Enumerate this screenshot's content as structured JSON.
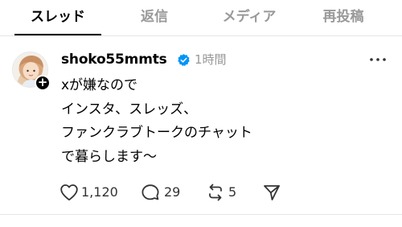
{
  "tabs": [
    {
      "label": "スレッド",
      "active": true
    },
    {
      "label": "返信",
      "active": false
    },
    {
      "label": "メディア",
      "active": false
    },
    {
      "label": "再投稿",
      "active": false
    }
  ],
  "post": {
    "username": "shoko55mmts",
    "verified": true,
    "timestamp": "1時間",
    "text_lines": [
      "xが嫌なので",
      "インスタ、スレッズ、",
      "ファンクラブトークのチャット",
      "で暮らします〜"
    ],
    "actions": {
      "likes": "1,120",
      "replies": "29",
      "reposts": "5"
    }
  },
  "icons": {
    "verified": "verified-badge-icon",
    "more": "more-horizontal-icon",
    "like": "heart-icon",
    "reply": "comment-bubble-icon",
    "repost": "repost-icon",
    "share": "send-icon",
    "follow": "plus-icon"
  },
  "colors": {
    "verified_blue": "#0095f6",
    "muted_text": "#999999",
    "text": "#000000",
    "divider": "#e5e5e5"
  }
}
